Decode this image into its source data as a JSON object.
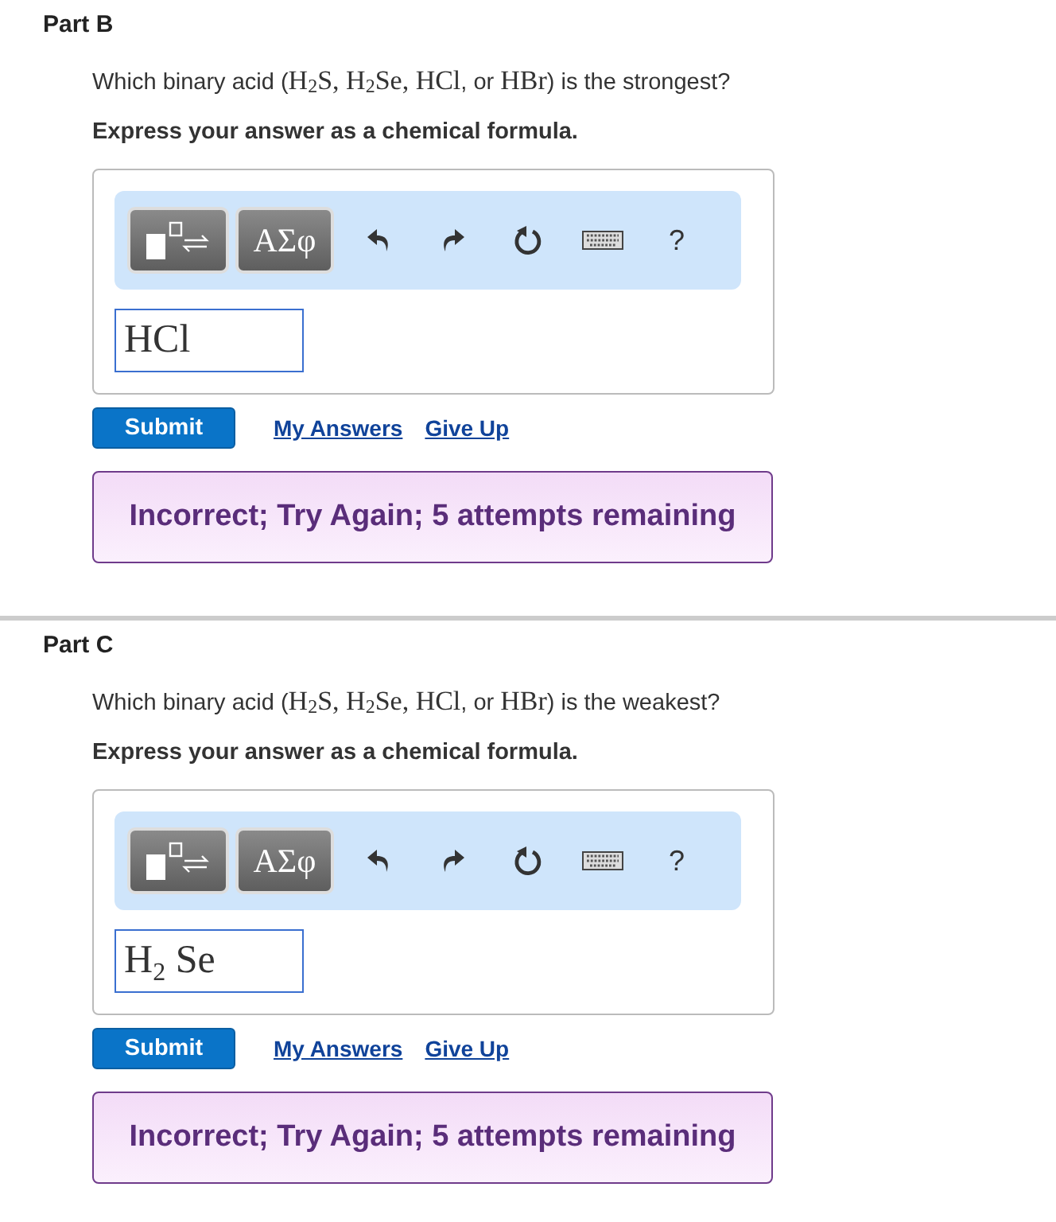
{
  "parts": [
    {
      "title": "Part B",
      "question": [
        {
          "kind": "text",
          "text": "Which binary acid ("
        },
        {
          "kind": "math",
          "text": "H$_{2}$S, H$_{2}$Se, HCl"
        },
        {
          "kind": "text",
          "text": ", or "
        },
        {
          "kind": "math",
          "text": "HBr"
        },
        {
          "kind": "text",
          "text": ") is the strongest?"
        }
      ],
      "instruction": "Express your answer as a chemical formula.",
      "toolbar": [
        {
          "kind": "template"
        },
        {
          "kind": "symbols",
          "label": "ΑΣφ"
        },
        {
          "kind": "undo"
        },
        {
          "kind": "redo"
        },
        {
          "kind": "reset"
        },
        {
          "kind": "keyboard"
        },
        {
          "kind": "help",
          "label": "?"
        }
      ],
      "answer": "HCl",
      "submit": "Submit",
      "links": [
        "My Answers",
        "Give Up"
      ],
      "feedback": "Incorrect; Try Again; 5 attempts remaining"
    },
    {
      "title": "Part C",
      "question": [
        {
          "kind": "text",
          "text": "Which binary acid ("
        },
        {
          "kind": "math",
          "text": "H$_{2}$S, H$_{2}$Se, HCl"
        },
        {
          "kind": "text",
          "text": ", or "
        },
        {
          "kind": "math",
          "text": "HBr"
        },
        {
          "kind": "text",
          "text": ") is the weakest?"
        }
      ],
      "instruction": "Express your answer as a chemical formula.",
      "toolbar": [
        {
          "kind": "template"
        },
        {
          "kind": "symbols",
          "label": "ΑΣφ"
        },
        {
          "kind": "undo"
        },
        {
          "kind": "redo"
        },
        {
          "kind": "reset"
        },
        {
          "kind": "keyboard"
        },
        {
          "kind": "help",
          "label": "?"
        }
      ],
      "answer": "H$_{2}$ Se",
      "submit": "Submit",
      "links": [
        "My Answers",
        "Give Up"
      ],
      "feedback": "Incorrect; Try Again; 5 attempts remaining"
    }
  ]
}
